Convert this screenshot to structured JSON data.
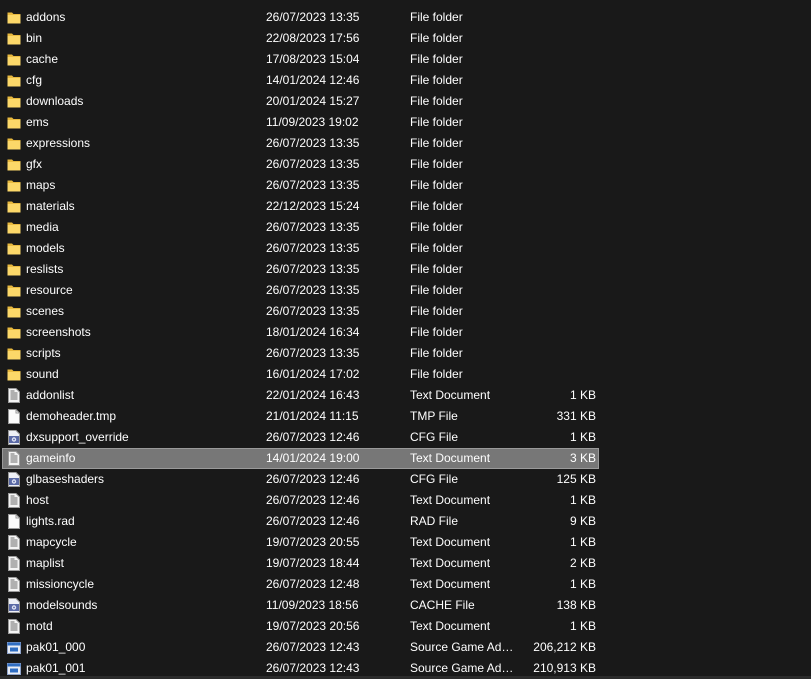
{
  "files": [
    {
      "name": "addons",
      "date": "26/07/2023 13:35",
      "type": "File folder",
      "size": "",
      "icon": "folder-icon"
    },
    {
      "name": "bin",
      "date": "22/08/2023 17:56",
      "type": "File folder",
      "size": "",
      "icon": "folder-icon"
    },
    {
      "name": "cache",
      "date": "17/08/2023 15:04",
      "type": "File folder",
      "size": "",
      "icon": "folder-icon"
    },
    {
      "name": "cfg",
      "date": "14/01/2024 12:46",
      "type": "File folder",
      "size": "",
      "icon": "folder-icon"
    },
    {
      "name": "downloads",
      "date": "20/01/2024 15:27",
      "type": "File folder",
      "size": "",
      "icon": "folder-icon"
    },
    {
      "name": "ems",
      "date": "11/09/2023 19:02",
      "type": "File folder",
      "size": "",
      "icon": "folder-icon"
    },
    {
      "name": "expressions",
      "date": "26/07/2023 13:35",
      "type": "File folder",
      "size": "",
      "icon": "folder-icon"
    },
    {
      "name": "gfx",
      "date": "26/07/2023 13:35",
      "type": "File folder",
      "size": "",
      "icon": "folder-icon"
    },
    {
      "name": "maps",
      "date": "26/07/2023 13:35",
      "type": "File folder",
      "size": "",
      "icon": "folder-icon"
    },
    {
      "name": "materials",
      "date": "22/12/2023 15:24",
      "type": "File folder",
      "size": "",
      "icon": "folder-icon"
    },
    {
      "name": "media",
      "date": "26/07/2023 13:35",
      "type": "File folder",
      "size": "",
      "icon": "folder-icon"
    },
    {
      "name": "models",
      "date": "26/07/2023 13:35",
      "type": "File folder",
      "size": "",
      "icon": "folder-icon"
    },
    {
      "name": "reslists",
      "date": "26/07/2023 13:35",
      "type": "File folder",
      "size": "",
      "icon": "folder-icon"
    },
    {
      "name": "resource",
      "date": "26/07/2023 13:35",
      "type": "File folder",
      "size": "",
      "icon": "folder-icon"
    },
    {
      "name": "scenes",
      "date": "26/07/2023 13:35",
      "type": "File folder",
      "size": "",
      "icon": "folder-icon"
    },
    {
      "name": "screenshots",
      "date": "18/01/2024 16:34",
      "type": "File folder",
      "size": "",
      "icon": "folder-icon"
    },
    {
      "name": "scripts",
      "date": "26/07/2023 13:35",
      "type": "File folder",
      "size": "",
      "icon": "folder-icon"
    },
    {
      "name": "sound",
      "date": "16/01/2024 17:02",
      "type": "File folder",
      "size": "",
      "icon": "folder-icon"
    },
    {
      "name": "addonlist",
      "date": "22/01/2024 16:43",
      "type": "Text Document",
      "size": "1 KB",
      "icon": "text-document-icon"
    },
    {
      "name": "demoheader.tmp",
      "date": "21/01/2024 11:15",
      "type": "TMP File",
      "size": "331 KB",
      "icon": "blank-file-icon"
    },
    {
      "name": "dxsupport_override",
      "date": "26/07/2023 12:46",
      "type": "CFG File",
      "size": "1 KB",
      "icon": "config-file-icon"
    },
    {
      "name": "gameinfo",
      "date": "14/01/2024 19:00",
      "type": "Text Document",
      "size": "3 KB",
      "icon": "text-document-icon",
      "selected": true
    },
    {
      "name": "glbaseshaders",
      "date": "26/07/2023 12:46",
      "type": "CFG File",
      "size": "125 KB",
      "icon": "config-file-icon"
    },
    {
      "name": "host",
      "date": "26/07/2023 12:46",
      "type": "Text Document",
      "size": "1 KB",
      "icon": "text-document-icon"
    },
    {
      "name": "lights.rad",
      "date": "26/07/2023 12:46",
      "type": "RAD File",
      "size": "9 KB",
      "icon": "blank-file-icon"
    },
    {
      "name": "mapcycle",
      "date": "19/07/2023 20:55",
      "type": "Text Document",
      "size": "1 KB",
      "icon": "text-document-icon"
    },
    {
      "name": "maplist",
      "date": "19/07/2023 18:44",
      "type": "Text Document",
      "size": "2 KB",
      "icon": "text-document-icon"
    },
    {
      "name": "missioncycle",
      "date": "26/07/2023 12:48",
      "type": "Text Document",
      "size": "1 KB",
      "icon": "text-document-icon"
    },
    {
      "name": "modelsounds",
      "date": "11/09/2023 18:56",
      "type": "CACHE File",
      "size": "138 KB",
      "icon": "config-file-icon"
    },
    {
      "name": "motd",
      "date": "19/07/2023 20:56",
      "type": "Text Document",
      "size": "1 KB",
      "icon": "text-document-icon"
    },
    {
      "name": "pak01_000",
      "date": "26/07/2023 12:43",
      "type": "Source Game Add...",
      "size": "206,212 KB",
      "icon": "source-package-icon"
    },
    {
      "name": "pak01_001",
      "date": "26/07/2023 12:43",
      "type": "Source Game Add...",
      "size": "210,913 KB",
      "icon": "source-package-icon"
    }
  ],
  "colors": {
    "background": "#191919",
    "text": "#ffffff",
    "selection": "#777777",
    "folder": "#f6d66a"
  }
}
